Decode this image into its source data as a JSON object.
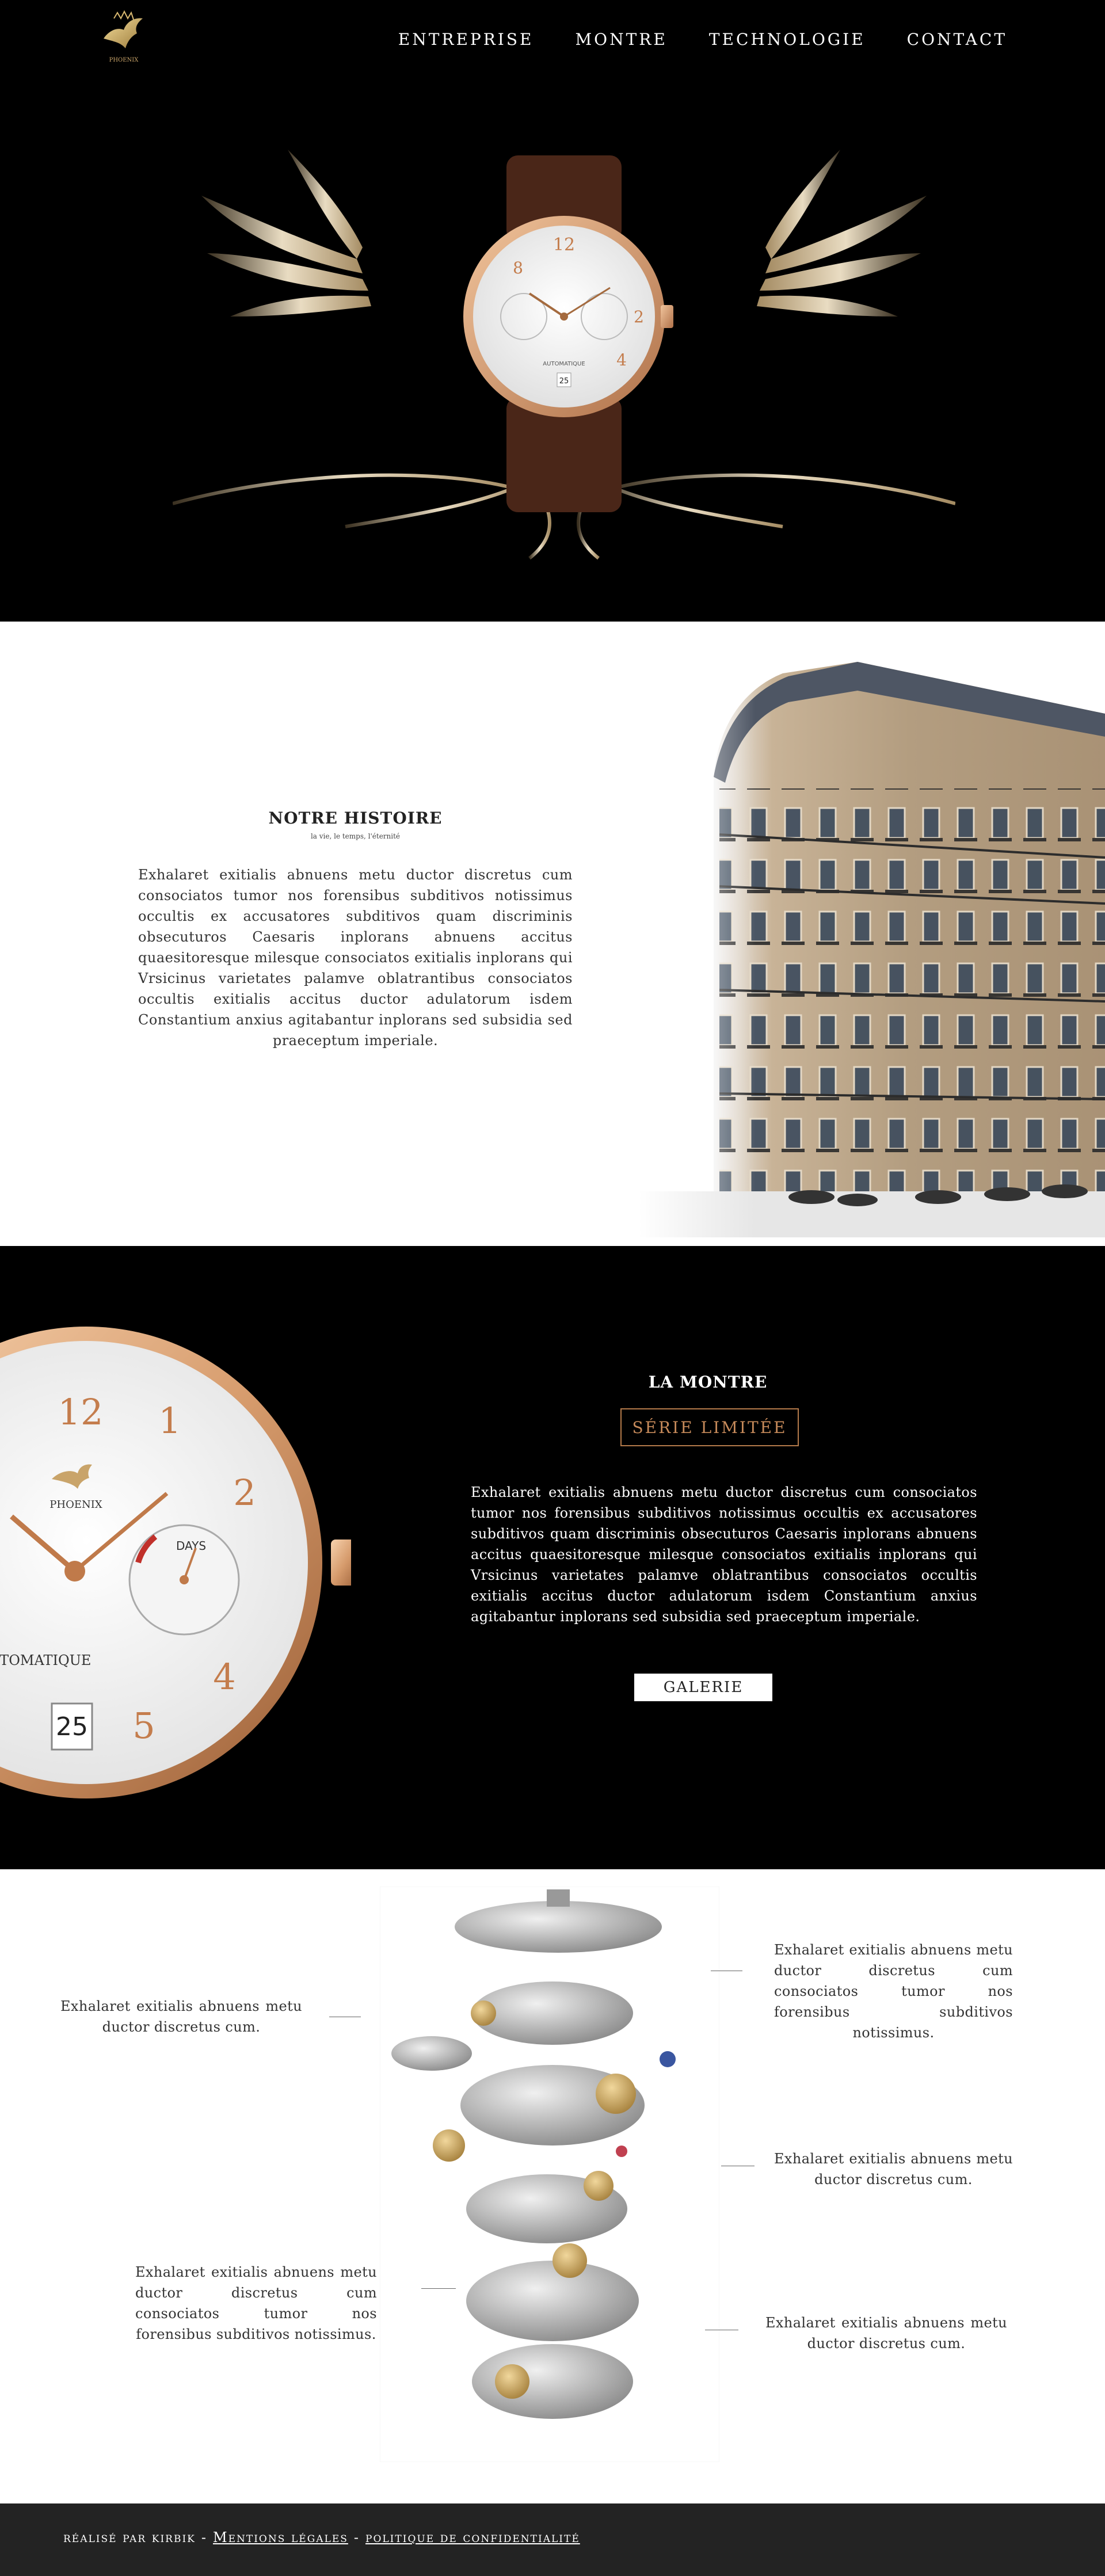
{
  "nav": {
    "items": [
      "ENTREPRISE",
      "MONTRE",
      "TECHNOLOGIE",
      "CONTACT"
    ],
    "logo_text": "PHOENIX"
  },
  "histoire": {
    "title": "NOTRE HISTOIRE",
    "subtitle": "la vie, le temps, l'éternité",
    "body": "Exhalaret exitialis abnuens metu ductor discretus cum consociatos tumor nos forensibus subditivos notissimus occultis ex accusatores subditivos quam discriminis obsecuturos Caesaris inplorans abnuens accitus quaesitoresque milesque consociatos exitialis inplorans qui Vrsicinus varietates palamve oblatrantibus consociatos occultis exitialis accitus ductor adulatorum isdem Constantium anxius agitabantur inplorans sed subsidia sed praeceptum imperiale."
  },
  "montre": {
    "title": "LA MONTRE",
    "badge": "SÉRIE LIMITÉE",
    "body": "Exhalaret exitialis abnuens metu ductor discretus cum consociatos tumor nos forensibus subditivos notissimus occultis ex accusatores subditivos quam discriminis obsecuturos Caesaris inplorans abnuens accitus quaesitoresque milesque consociatos exitialis inplorans qui Vrsicinus varietates palamve oblatrantibus consociatos occultis exitialis accitus ductor adulatorum isdem Constantium anxius agitabantur inplorans sed subsidia sed praeceptum imperiale.",
    "button": "GALERIE",
    "dial": {
      "brand": "PHOENIX",
      "label": "AUTOMATIQUE",
      "date": "25",
      "days": "DAYS",
      "numerals": [
        "12",
        "1",
        "2",
        "4",
        "5"
      ]
    }
  },
  "techno": {
    "left_top": "Exhalaret exitialis abnuens metu ductor discretus cum.",
    "left_bottom": "Exhalaret exitialis abnuens metu ductor discretus cum consociatos tumor nos forensibus subditivos notissimus.",
    "right_top": "Exhalaret exitialis abnuens metu ductor discretus cum consociatos tumor nos forensibus subditivos notissimus.",
    "right_middle": "Exhalaret exitialis abnuens metu ductor discretus cum.",
    "right_bottom": "Exhalaret exitialis abnuens metu ductor discretus cum."
  },
  "footer": {
    "credit": "réalisé par kirbik",
    "sep1": "-",
    "legal": "Mentions légales",
    "sep2": "-",
    "privacy": "politique de confidentialité"
  },
  "colors": {
    "gold": "#c9a46a",
    "rose_gold": "#d49a6a",
    "badge": "#c68a5a",
    "footer_bg": "#232323"
  }
}
